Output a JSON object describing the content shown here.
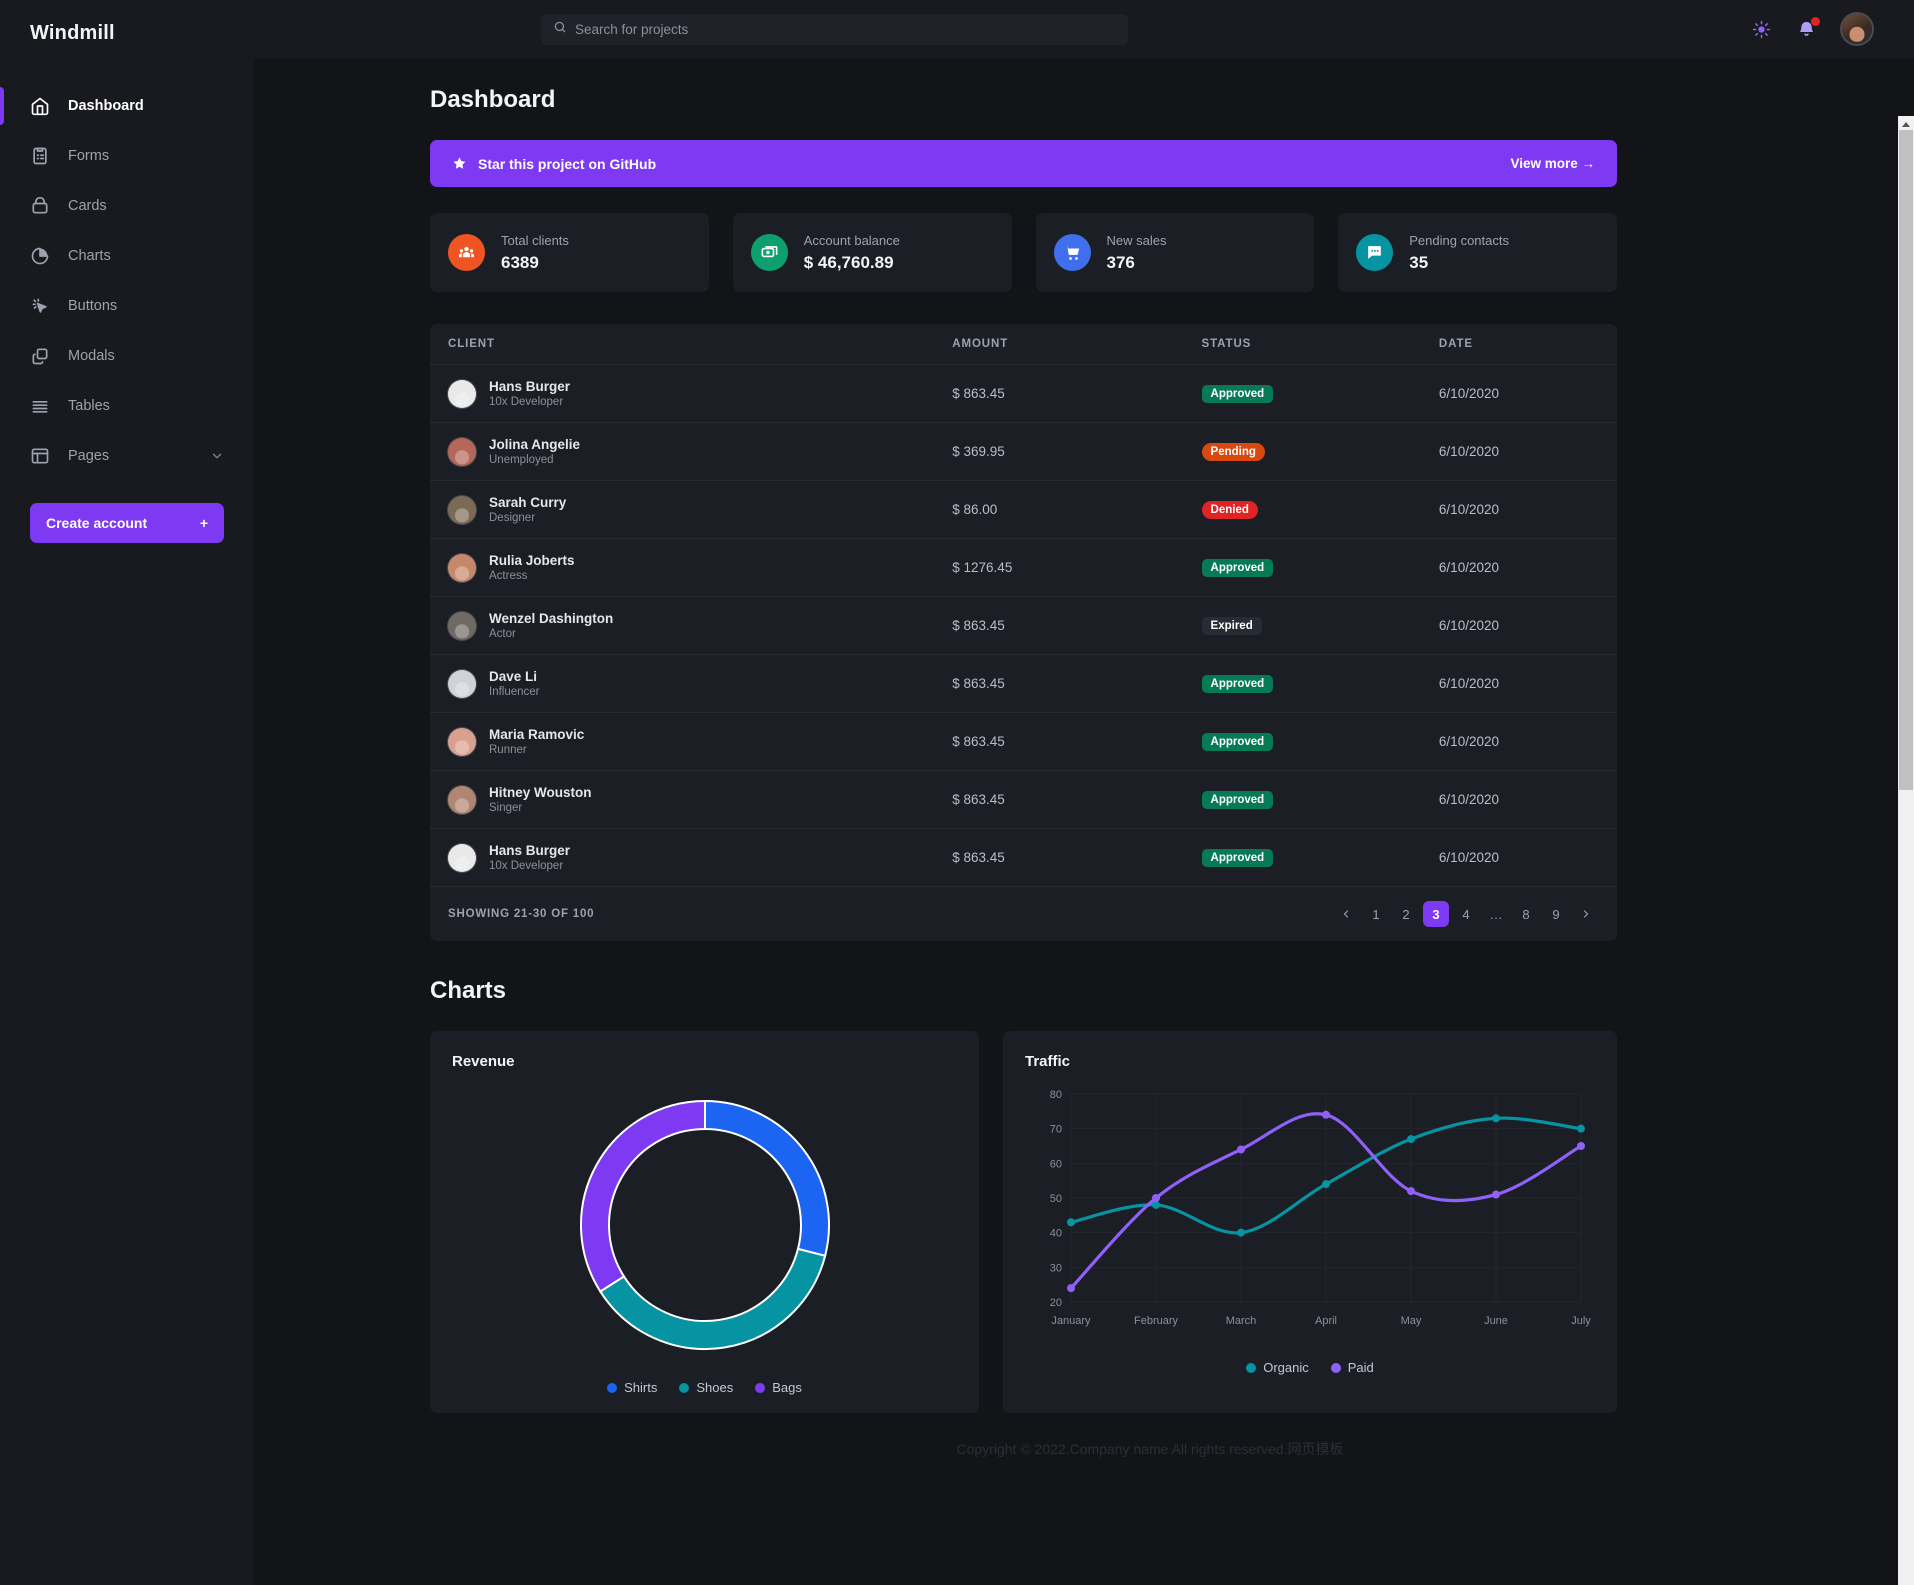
{
  "brand": "Windmill",
  "sidebar": {
    "items": [
      {
        "label": "Dashboard",
        "icon": "home-icon",
        "active": true
      },
      {
        "label": "Forms",
        "icon": "forms-icon",
        "active": false
      },
      {
        "label": "Cards",
        "icon": "cards-icon",
        "active": false
      },
      {
        "label": "Charts",
        "icon": "charts-icon",
        "active": false
      },
      {
        "label": "Buttons",
        "icon": "buttons-icon",
        "active": false
      },
      {
        "label": "Modals",
        "icon": "modals-icon",
        "active": false
      },
      {
        "label": "Tables",
        "icon": "tables-icon",
        "active": false
      },
      {
        "label": "Pages",
        "icon": "pages-icon",
        "active": false,
        "expandable": true
      }
    ],
    "cta_label": "Create account",
    "cta_plus": "+"
  },
  "topbar": {
    "search_placeholder": "Search for projects",
    "search_value": "",
    "theme_icon": "sun-icon",
    "notification_icon": "bell-icon",
    "has_notification": true,
    "avatar": "user-avatar"
  },
  "page": {
    "title": "Dashboard",
    "charts_title": "Charts"
  },
  "banner": {
    "text": "Star this project on GitHub",
    "link": "View more →",
    "color": "#7e3af2"
  },
  "stats": [
    {
      "label": "Total clients",
      "value": "6389",
      "icon": "people-icon",
      "color": "#f05423"
    },
    {
      "label": "Account balance",
      "value": "$ 46,760.89",
      "icon": "money-icon",
      "color": "#0e9f6e"
    },
    {
      "label": "New sales",
      "value": "376",
      "icon": "cart-icon",
      "color": "#3f6fed"
    },
    {
      "label": "Pending contacts",
      "value": "35",
      "icon": "chat-icon",
      "color": "#0694a2"
    }
  ],
  "table": {
    "columns": [
      "CLIENT",
      "AMOUNT",
      "STATUS",
      "DATE"
    ],
    "rows": [
      {
        "name": "Hans Burger",
        "role": "10x Developer",
        "amount": "$ 863.45",
        "status": "Approved",
        "status_type": "approved",
        "date": "6/10/2020",
        "avatar_color": "#e9e9ea"
      },
      {
        "name": "Jolina Angelie",
        "role": "Unemployed",
        "amount": "$ 369.95",
        "status": "Pending",
        "status_type": "pending",
        "date": "6/10/2020",
        "avatar_color": "#b5675a"
      },
      {
        "name": "Sarah Curry",
        "role": "Designer",
        "amount": "$ 86.00",
        "status": "Denied",
        "status_type": "denied",
        "date": "6/10/2020",
        "avatar_color": "#7b6a55"
      },
      {
        "name": "Rulia Joberts",
        "role": "Actress",
        "amount": "$ 1276.45",
        "status": "Approved",
        "status_type": "approved",
        "date": "6/10/2020",
        "avatar_color": "#c4896b"
      },
      {
        "name": "Wenzel Dashington",
        "role": "Actor",
        "amount": "$ 863.45",
        "status": "Expired",
        "status_type": "expired",
        "date": "6/10/2020",
        "avatar_color": "#6f6a63"
      },
      {
        "name": "Dave Li",
        "role": "Influencer",
        "amount": "$ 863.45",
        "status": "Approved",
        "status_type": "approved",
        "date": "6/10/2020",
        "avatar_color": "#cfd3d8"
      },
      {
        "name": "Maria Ramovic",
        "role": "Runner",
        "amount": "$ 863.45",
        "status": "Approved",
        "status_type": "approved",
        "date": "6/10/2020",
        "avatar_color": "#d8a08e"
      },
      {
        "name": "Hitney Wouston",
        "role": "Singer",
        "amount": "$ 863.45",
        "status": "Approved",
        "status_type": "approved",
        "date": "6/10/2020",
        "avatar_color": "#b08572"
      },
      {
        "name": "Hans Burger",
        "role": "10x Developer",
        "amount": "$ 863.45",
        "status": "Approved",
        "status_type": "approved",
        "date": "6/10/2020",
        "avatar_color": "#e9e9ea"
      }
    ],
    "showing": "SHOWING 21-30 OF 100",
    "pagination": {
      "prev_icon": "chevron-left-icon",
      "next_icon": "chevron-right-icon",
      "pages": [
        "1",
        "2",
        "3",
        "4",
        "…",
        "8",
        "9"
      ],
      "current": "3"
    }
  },
  "chart_data": [
    {
      "type": "pie",
      "title": "Revenue",
      "labels": [
        "Shirts",
        "Shoes",
        "Bags"
      ],
      "values": [
        29,
        37,
        34
      ],
      "colors": [
        "#1c64f2",
        "#0694a2",
        "#7e3af2"
      ],
      "donut": true,
      "legend": "bottom"
    },
    {
      "type": "line",
      "title": "Traffic",
      "categories": [
        "January",
        "February",
        "March",
        "April",
        "May",
        "June",
        "July"
      ],
      "series": [
        {
          "name": "Organic",
          "values": [
            43,
            48,
            40,
            54,
            67,
            73,
            70
          ],
          "color": "#0694a2"
        },
        {
          "name": "Paid",
          "values": [
            24,
            50,
            64,
            74,
            52,
            51,
            65
          ],
          "color": "#9061f9"
        }
      ],
      "ylim": [
        20,
        80
      ],
      "yticks": [
        20,
        30,
        40,
        50,
        60,
        70,
        80
      ],
      "xlabel": "",
      "ylabel": "",
      "grid": true,
      "legend": "bottom"
    }
  ],
  "footer": {
    "text": "Copyright © 2022.Company name All rights reserved.网页模板"
  }
}
